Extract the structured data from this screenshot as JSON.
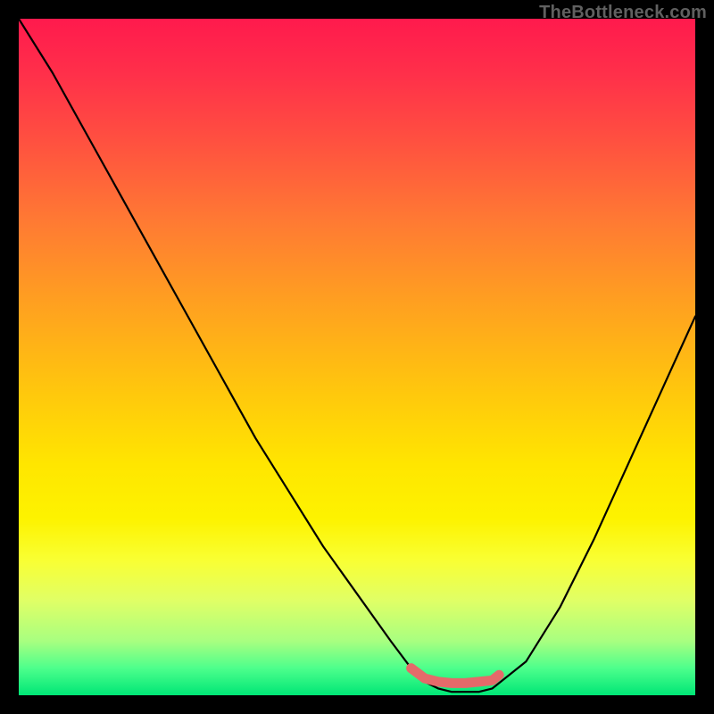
{
  "watermark": "TheBottleneck.com",
  "colors": {
    "frame": "#000000",
    "curve": "#000000",
    "marker": "#e46a6a"
  },
  "chart_data": {
    "type": "line",
    "title": "",
    "xlabel": "",
    "ylabel": "",
    "xlim": [
      0,
      100
    ],
    "ylim": [
      0,
      100
    ],
    "series": [
      {
        "name": "bottleneck-curve",
        "x": [
          0,
          5,
          10,
          15,
          20,
          25,
          30,
          35,
          40,
          45,
          50,
          55,
          58,
          60,
          62,
          64,
          66,
          68,
          70,
          75,
          80,
          85,
          90,
          95,
          100
        ],
        "values": [
          100,
          92,
          83,
          74,
          65,
          56,
          47,
          38,
          30,
          22,
          15,
          8,
          4,
          2,
          1,
          0.5,
          0.5,
          0.5,
          1,
          5,
          13,
          23,
          34,
          45,
          56
        ]
      }
    ],
    "highlight": {
      "name": "optimal-range",
      "x": [
        58,
        60,
        62,
        64,
        66,
        68,
        70,
        71
      ],
      "values": [
        4,
        2.5,
        2,
        1.8,
        1.8,
        2,
        2.2,
        3
      ]
    }
  }
}
